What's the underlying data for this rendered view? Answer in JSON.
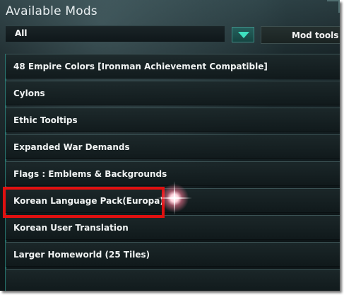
{
  "window": {
    "title": "Available Mods"
  },
  "toolbar": {
    "filter_value": "All",
    "dropdown_icon": "chevron-down-icon",
    "mod_tools_label": "Mod tools"
  },
  "mods": [
    {
      "label": "48 Empire Colors [Ironman Achievement Compatible]"
    },
    {
      "label": "Cylons"
    },
    {
      "label": "Ethic Tooltips"
    },
    {
      "label": "Expanded War Demands"
    },
    {
      "label": "Flags : Emblems & Backgrounds"
    },
    {
      "label": "Korean Language Pack(Europa)",
      "highlighted": true
    },
    {
      "label": "Korean User Translation"
    },
    {
      "label": "Larger Homeworld (25 Tiles)"
    }
  ],
  "colors": {
    "accent": "#3ee0c0",
    "highlight": "#e01010",
    "background": "#0c1417"
  }
}
